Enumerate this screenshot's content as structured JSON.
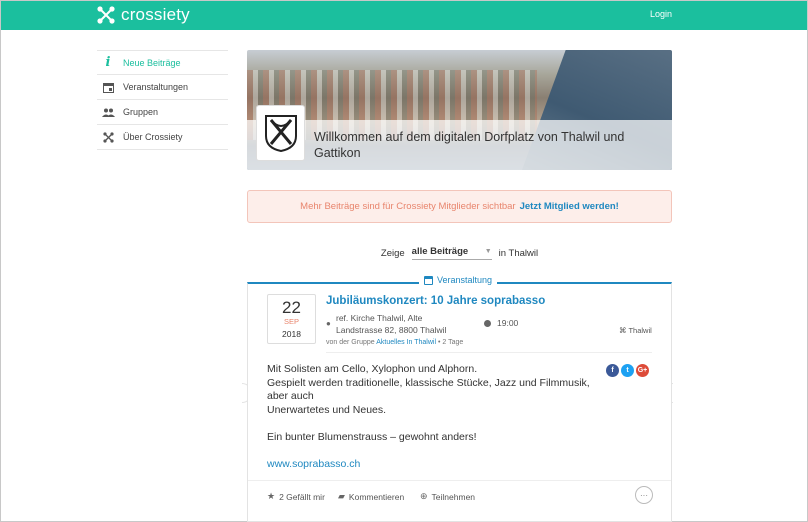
{
  "header": {
    "brand": "crossiety",
    "login_label": "Login",
    "color": "#1bbf9e"
  },
  "sidebar": {
    "items": [
      {
        "label": "Neue Beiträge",
        "icon": "info-icon",
        "active": true
      },
      {
        "label": "Veranstaltungen",
        "icon": "calendar-icon",
        "active": false
      },
      {
        "label": "Gruppen",
        "icon": "people-icon",
        "active": false
      },
      {
        "label": "Über Crossiety",
        "icon": "crossiety-icon",
        "active": false
      }
    ]
  },
  "hero": {
    "title": "Willkommen auf dem digitalen Dorfplatz von Thalwil und Gattikon"
  },
  "notice": {
    "text": "Mehr Beiträge sind für Crossiety Mitglieder sichtbar",
    "link": "Jetzt Mitglied werden!"
  },
  "filter": {
    "prefix": "Zeige",
    "selected": "alle Beiträge",
    "suffix": "in Thalwil"
  },
  "post": {
    "type_label": "Veranstaltung",
    "date": {
      "day": "22",
      "month": "SEP",
      "year": "2018"
    },
    "title": "Jubiläumskonzert: 10 Jahre soprabasso",
    "location_line1": "ref. Kirche Thalwil, Alte",
    "location_line2": "Landstrasse 82, 8800 Thalwil",
    "time": "19:00",
    "place": "Thalwil",
    "group_prefix": "von der Gruppe",
    "group_name": "Aktuelles In Thalwil",
    "age": "• 2 Tage",
    "body_p1_l1": "Mit Solisten am Cello, Xylophon und Alphorn.",
    "body_p1_l2": "Gespielt werden traditionelle, klassische Stücke, Jazz und Filmmusik,",
    "body_p1_l3": "aber auch",
    "body_p1_l4": "Unerwartetes und Neues.",
    "body_p2": "Ein bunter Blumenstrauss – gewohnt anders!",
    "url": "www.soprabasso.ch",
    "social": [
      {
        "label": "f",
        "icon": "facebook-icon",
        "color": "#3b5998"
      },
      {
        "label": "t",
        "icon": "twitter-icon",
        "color": "#1da1f2"
      },
      {
        "label": "G+",
        "icon": "google-plus-icon",
        "color": "#dd4b39"
      }
    ],
    "actions": {
      "likes": "2 Gefällt mir",
      "comments": "Kommentieren",
      "join": "Teilnehmen",
      "more": "···"
    }
  }
}
